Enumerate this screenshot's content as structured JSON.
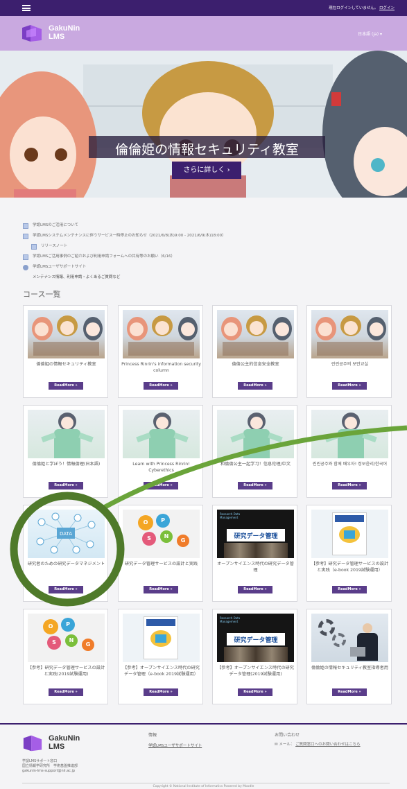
{
  "topbar": {
    "login_msg": "現在ログインしていません。",
    "login_link": "ログイン"
  },
  "header": {
    "logo_line1": "GakuNin",
    "logo_line2": "LMS",
    "language": "日本語 (ja) ▾"
  },
  "hero": {
    "title": "倫倫姫の情報セキュリティ教室",
    "button": "さらに詳しく ›"
  },
  "notices": [
    {
      "text": "学認LMSのご活用について",
      "sub": false,
      "icon": true
    },
    {
      "text": "学認LMSシステムメンテナンスに伴うサービス一時停止のお知らせ（2021/6/8(水)9:00 - 2021/6/9(木)18:00）",
      "sub": false,
      "icon": true
    },
    {
      "text": "リリースノート",
      "sub": true,
      "icon": true
    },
    {
      "text": "学認LMSご活用事例のご紹介および利用申請フォームへの共有等のお願い（6/16）",
      "sub": false,
      "icon": true
    },
    {
      "text": "学認LMSユーザサポートサイト",
      "sub": false,
      "icon": true
    },
    {
      "text": "メンテナンス情報、利用申請・よくあるご質問など",
      "sub": false,
      "icon": false
    }
  ],
  "section_title": "コース一覧",
  "readmore": "ReadMore »",
  "courses": [
    {
      "title": "倫倫姫の情報セキュリティ教室",
      "thumb": "room"
    },
    {
      "title": "Princess Rinrin's information security column",
      "thumb": "room"
    },
    {
      "title": "倫倫公主的信息安全教室",
      "thumb": "room"
    },
    {
      "title": "린린공주의 보안교실",
      "thumb": "room"
    },
    {
      "title": "倫倫姫と学ぼう！情報倫理(日本語)",
      "thumb": "kimono"
    },
    {
      "title": "Learn with Princess Rinrin! Cyberethics",
      "thumb": "kimono"
    },
    {
      "title": "和倫倫公主一起学习！信息伦理/中文",
      "thumb": "kimono"
    },
    {
      "title": "린린공주와 함께 배우자! 정보윤리/한국어",
      "thumb": "kimono"
    },
    {
      "title": "研究者のための研究データマネジメント",
      "thumb": "net"
    },
    {
      "title": "研究データ管理サービスの設計と実践",
      "thumb": "ops"
    },
    {
      "title": "オープンサイエンス時代の研究データ管理",
      "thumb": "dark"
    },
    {
      "title": "【参考】研究データ管理サービスの設計と実践（e-book 2019試験運用）",
      "thumb": "book"
    },
    {
      "title": "【参考】研究データ管理サービスの設計と実践(2019試験運用)",
      "thumb": "ops"
    },
    {
      "title": "【参考】オープンサイエンス時代の研究データ管理（e-book 2019試験運用）",
      "thumb": "book"
    },
    {
      "title": "【参考】オープンサイエンス時代の研究データ管理(2019試験運用)",
      "thumb": "dark"
    },
    {
      "title": "倫倫姫の情報セキュリティ教室指導者用",
      "thumb": "gear"
    }
  ],
  "thumb_text": {
    "net_label": "DATA",
    "ops_letters": [
      "O",
      "P",
      "S",
      "N",
      "G"
    ],
    "dark_caption": "研究データ管理",
    "dark_small": "Research Data Management"
  },
  "footer": {
    "logo_line1": "GakuNin",
    "logo_line2": "LMS",
    "org_line1": "学認LMSサポート窓口",
    "org_line2": "国立情報学研究所　学術基盤推進部",
    "org_line3": "gakunin-lms-support@nii.ac.jp",
    "info_head": "情報",
    "info_link": "学認LMSユーザサポートサイト",
    "contact_head": "お問い合わせ",
    "contact_mail": "✉ メール：",
    "contact_link": "ご質問窓口へのお問い合わせはこちら",
    "copyright": "Copyright © National Institute of Informatics   Powered by Moodle"
  },
  "colors": {
    "topbar": "#3c1f6e",
    "header": "#c9a9e0",
    "readmore": "#5a3d8a",
    "circle": "#4f7a2a",
    "arrow": "#6aa43a"
  }
}
